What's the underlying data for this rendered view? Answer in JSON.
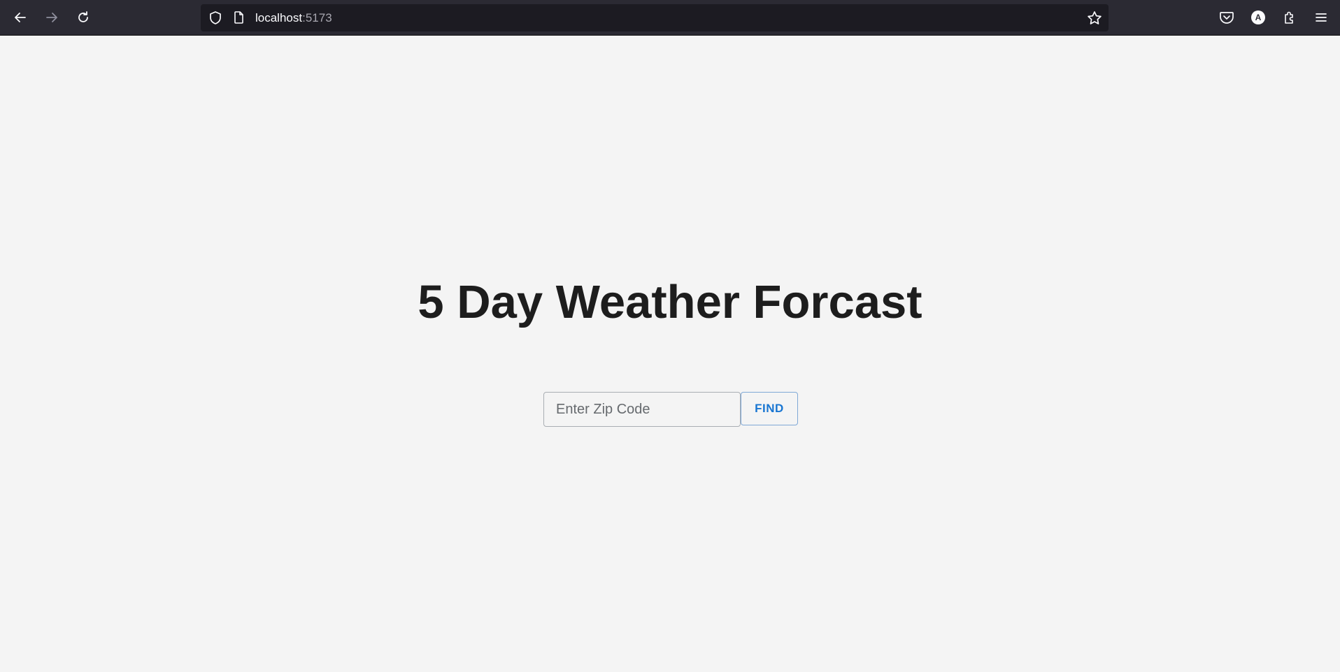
{
  "browser": {
    "url_host": "localhost",
    "url_port": ":5173",
    "icons": {
      "back": "back-arrow-icon",
      "forward": "forward-arrow-icon",
      "reload": "reload-icon",
      "tracking": "shield-icon",
      "page": "page-icon",
      "bookmark": "star-icon",
      "pocket": "pocket-icon",
      "account": "account-icon",
      "extensions": "puzzle-icon",
      "menu": "hamburger-menu-icon"
    },
    "account_initial": "A",
    "colors": {
      "toolbar": "#2b2a33",
      "urlbar": "#1c1b22"
    }
  },
  "page": {
    "title": "5 Day Weather Forcast",
    "zip_input": {
      "value": "",
      "placeholder": "Enter Zip Code"
    },
    "find_label": "FIND",
    "colors": {
      "background": "#f4f4f4",
      "accent": "#1976d2"
    }
  }
}
